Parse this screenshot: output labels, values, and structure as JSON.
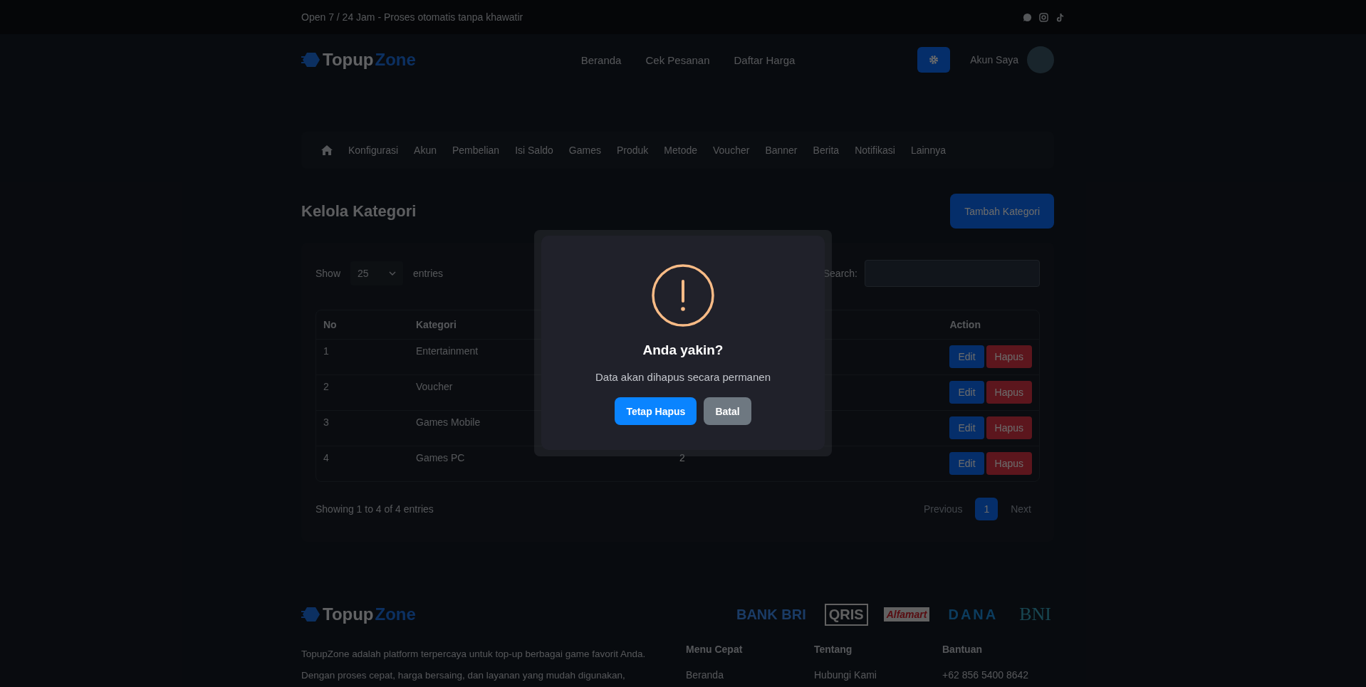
{
  "top_bar": {
    "text": "Open 7 / 24 Jam - Proses otomatis tanpa khawatir"
  },
  "header": {
    "logo": {
      "primary": "Topup",
      "secondary": "Zone"
    },
    "nav": [
      "Beranda",
      "Cek Pesanan",
      "Daftar Harga"
    ],
    "account": "Akun Saya"
  },
  "admin_menu": [
    "Konfigurasi",
    "Akun",
    "Pembelian",
    "Isi Saldo",
    "Games",
    "Produk",
    "Metode",
    "Voucher",
    "Banner",
    "Berita",
    "Notifikasi",
    "Lainnya"
  ],
  "page_title": "Kelola Kategori",
  "add_button": "Tambah Kategori",
  "table_controls": {
    "show_label": "Show",
    "length": "25",
    "entries_label": "entries",
    "search_label": "Search:"
  },
  "table": {
    "columns": [
      "No",
      "Kategori",
      "Action"
    ],
    "rows": [
      {
        "no": "1",
        "kategori": "Entertainment",
        "actions": [
          "Edit",
          "Hapus"
        ]
      },
      {
        "no": "2",
        "kategori": "Voucher",
        "actions": [
          "Edit",
          "Hapus"
        ]
      },
      {
        "no": "3",
        "kategori": "Games Mobile",
        "actions": [
          "Edit",
          "Hapus"
        ]
      },
      {
        "no": "4",
        "kategori": "Games PC",
        "column_3": "2",
        "actions": [
          "Edit",
          "Hapus"
        ]
      }
    ]
  },
  "table_info": "Showing 1 to 4 of 4 entries",
  "pagination": [
    {
      "label": "Previous",
      "selected": false
    },
    {
      "label": "1",
      "selected": true
    },
    {
      "label": "Next",
      "selected": false
    }
  ],
  "modal": {
    "title": "Anda yakin?",
    "message": "Data akan dihapus secara permanen",
    "confirm": "Tetap Hapus",
    "cancel": "Batal"
  },
  "footer": {
    "logo": {
      "primary": "Topup",
      "secondary": "Zone"
    },
    "payments": [
      "BANK BRI",
      "QRIS",
      "Alfamart",
      "DANA",
      "BNI"
    ],
    "description": [
      "TopupZone adalah platform terpercaya untuk top-up berbagai game favorit Anda.",
      "Dengan proses cepat, harga bersaing, dan layanan yang mudah digunakan,"
    ],
    "columns": [
      {
        "title": "Menu Cepat",
        "links": [
          "Beranda"
        ]
      },
      {
        "title": "Tentang",
        "links": [
          "Hubungi Kami"
        ]
      },
      {
        "title": "Bantuan",
        "links": [
          "+62 856 5400 8642"
        ]
      }
    ]
  }
}
